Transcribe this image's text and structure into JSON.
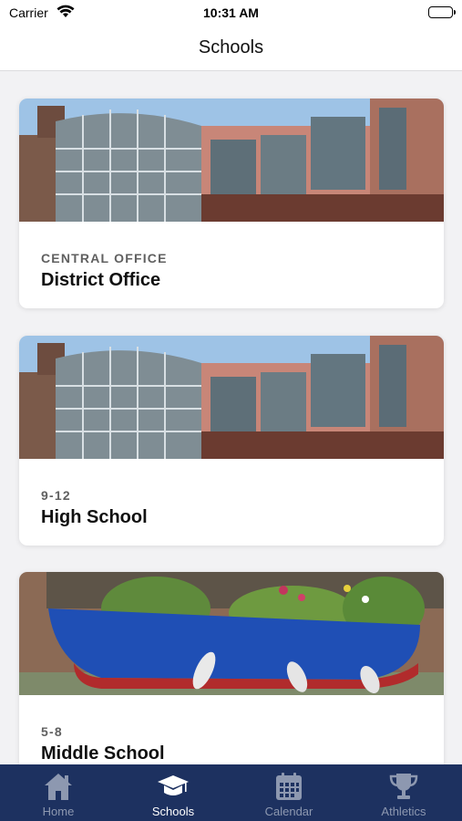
{
  "status_bar": {
    "carrier": "Carrier",
    "time": "10:31 AM"
  },
  "nav": {
    "title": "Schools"
  },
  "schools": [
    {
      "subtitle": "CENTRAL OFFICE",
      "title": "District Office",
      "image": "building-photo"
    },
    {
      "subtitle": "9-12",
      "title": "High School",
      "image": "building-photo"
    },
    {
      "subtitle": "5-8",
      "title": "Middle School",
      "image": "boat-garden-photo"
    }
  ],
  "tabs": [
    {
      "label": "Home",
      "icon": "home-icon",
      "active": false
    },
    {
      "label": "Schools",
      "icon": "graduation-cap-icon",
      "active": true
    },
    {
      "label": "Calendar",
      "icon": "calendar-icon",
      "active": false
    },
    {
      "label": "Athletics",
      "icon": "trophy-icon",
      "active": false
    }
  ],
  "colors": {
    "tab_bar": "#1d3160",
    "tab_active": "#ffffff",
    "tab_inactive": "#8d98b0"
  }
}
